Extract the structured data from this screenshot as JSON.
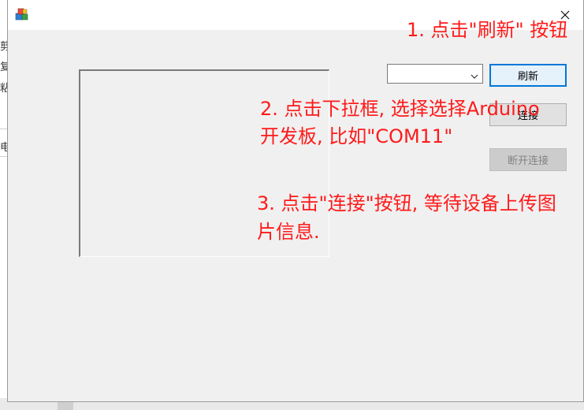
{
  "background": {
    "fragments": [
      "剪",
      "复",
      "粘",
      "电"
    ]
  },
  "dialog": {
    "app_icon": "app-cubes-icon",
    "close_icon": "close-icon",
    "combo": {
      "value": "",
      "arrow_icon": "chevron-down-icon"
    },
    "buttons": {
      "refresh": "刷新",
      "connect": "连接",
      "disconnect": "断开连接"
    }
  },
  "annotations": {
    "step1": "1. 点击\"刷新\" 按钮",
    "step2_line1": "2. 点击下拉框, 选择选择Arduino",
    "step2_line2": "开发板, 比如\"COM11\"",
    "step3_line1": "3. 点击\"连接\"按钮, 等待设备上传图",
    "step3_line2": "片信息."
  },
  "colors": {
    "annotation": "#ff1a1a",
    "focus_border": "#0078d7",
    "window_bg": "#f0f0f0"
  }
}
